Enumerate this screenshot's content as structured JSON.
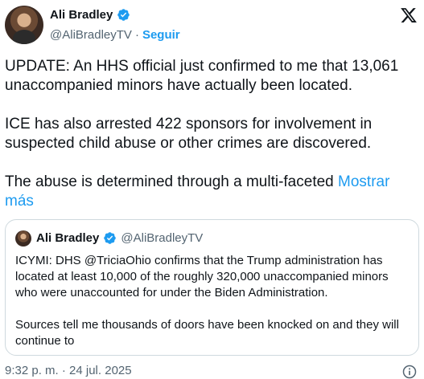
{
  "author": {
    "name": "Ali Bradley",
    "handle": "@AliBradleyTV",
    "separator": "·",
    "follow_label": "Seguir"
  },
  "tweet": {
    "paragraph1": "UPDATE: An HHS official just confirmed to me that 13,061 unaccompanied minors have actually been located.",
    "paragraph2": "ICE has also arrested 422 sponsors for involvement in suspected child abuse or other crimes are discovered.",
    "paragraph3": "The abuse is determined through a multi-faceted",
    "show_more": "Mostrar más"
  },
  "quote": {
    "name": "Ali Bradley",
    "handle": "@AliBradleyTV",
    "paragraph1": "ICYMI: DHS @TriciaOhio confirms that the Trump administration has located at least 10,000 of the roughly 320,000 unaccompanied minors who were unaccounted for under the Biden Administration.",
    "paragraph2": "Sources tell me thousands of doors have been knocked on and they will continue to"
  },
  "footer": {
    "timestamp": "9:32 p. m. · 24 jul. 2025"
  },
  "colors": {
    "accent": "#1d9bf0",
    "text": "#0f1419",
    "secondary": "#536471",
    "border": "#cfd9de"
  },
  "icons": {
    "verified": "verified-badge-icon",
    "platform": "x-logo-icon",
    "info": "info-icon"
  }
}
